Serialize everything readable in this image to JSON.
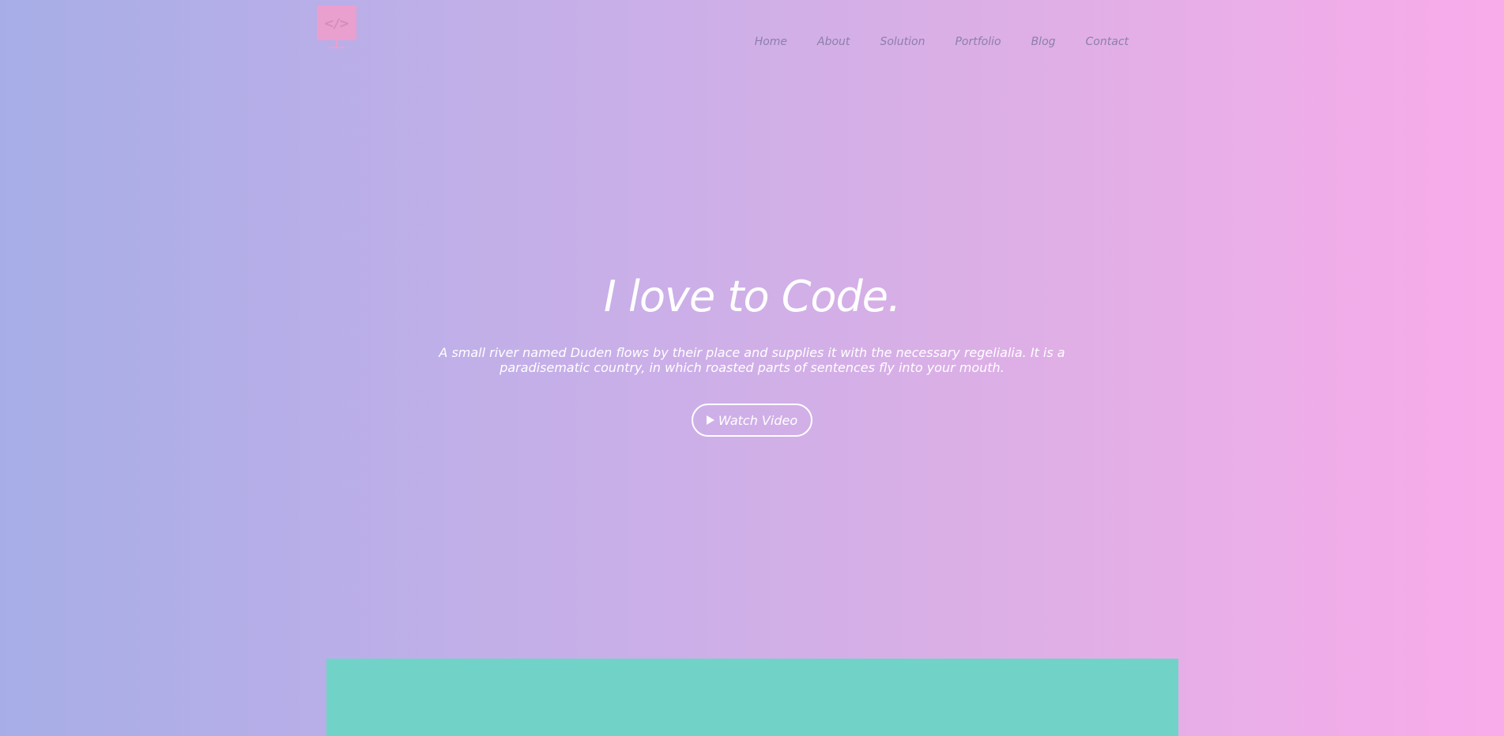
{
  "header": {
    "logo_icon": "code-monitor-icon",
    "nav": [
      {
        "label": "Home"
      },
      {
        "label": "About"
      },
      {
        "label": "Solution"
      },
      {
        "label": "Portfolio"
      },
      {
        "label": "Blog"
      },
      {
        "label": "Contact"
      }
    ]
  },
  "hero": {
    "title": "I love to Code.",
    "description": "A small river named Duden flows by their place and supplies it with the necessary regelialia. It is a paradisematic country, in which roasted parts of sentences fly into your mouth.",
    "button_label": "Watch Video",
    "button_icon": "play-icon"
  },
  "colors": {
    "gradient_start": "#a7aee7",
    "gradient_end": "#f9acea",
    "logo": "#e9a0cf",
    "nav_text": "#8b7faa",
    "hero_text": "#ffffff",
    "teal_panel": "#71d3c7"
  }
}
